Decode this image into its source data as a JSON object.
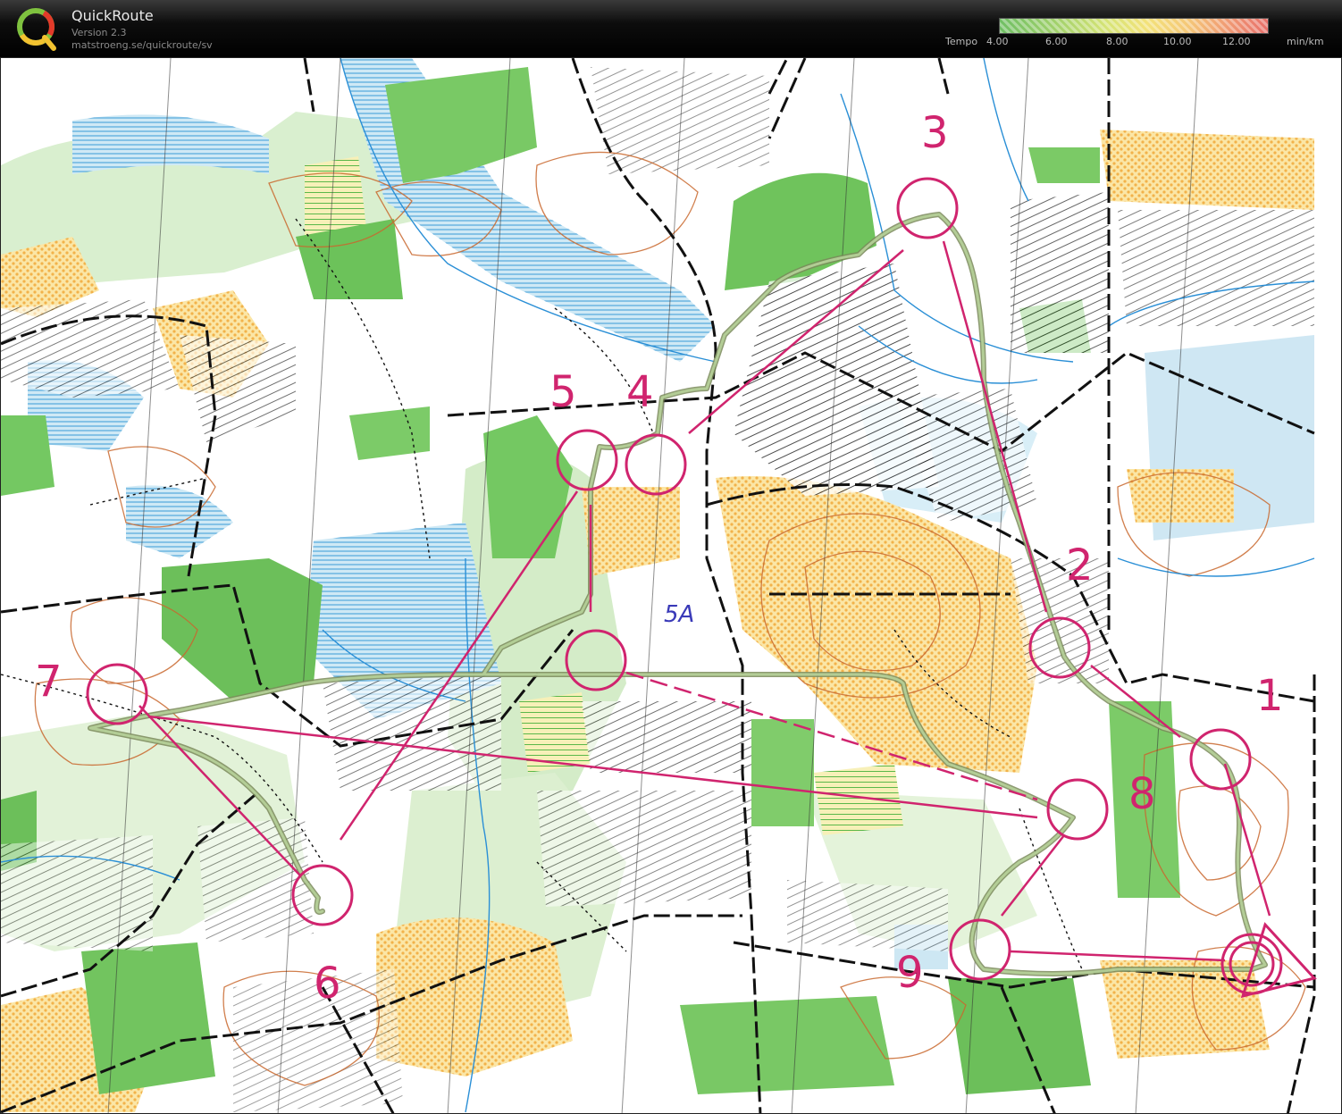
{
  "header": {
    "title": "QuickRoute",
    "version": "Version 2.3",
    "url": "matstroeng.se/quickroute/sv",
    "logo_letter": "Q"
  },
  "legend": {
    "label": "Tempo",
    "ticks": [
      "4.00",
      "6.00",
      "8.00",
      "10.00",
      "12.00"
    ],
    "unit": "min/km",
    "colors": [
      "#6fbf64",
      "#d6e476",
      "#f5c878",
      "#e8706a"
    ]
  },
  "map": {
    "course_color": "#d0246e",
    "route_color": "#8aa86a",
    "controls": [
      "1",
      "2",
      "3",
      "4",
      "5",
      "5A",
      "6",
      "7",
      "8",
      "9"
    ]
  }
}
